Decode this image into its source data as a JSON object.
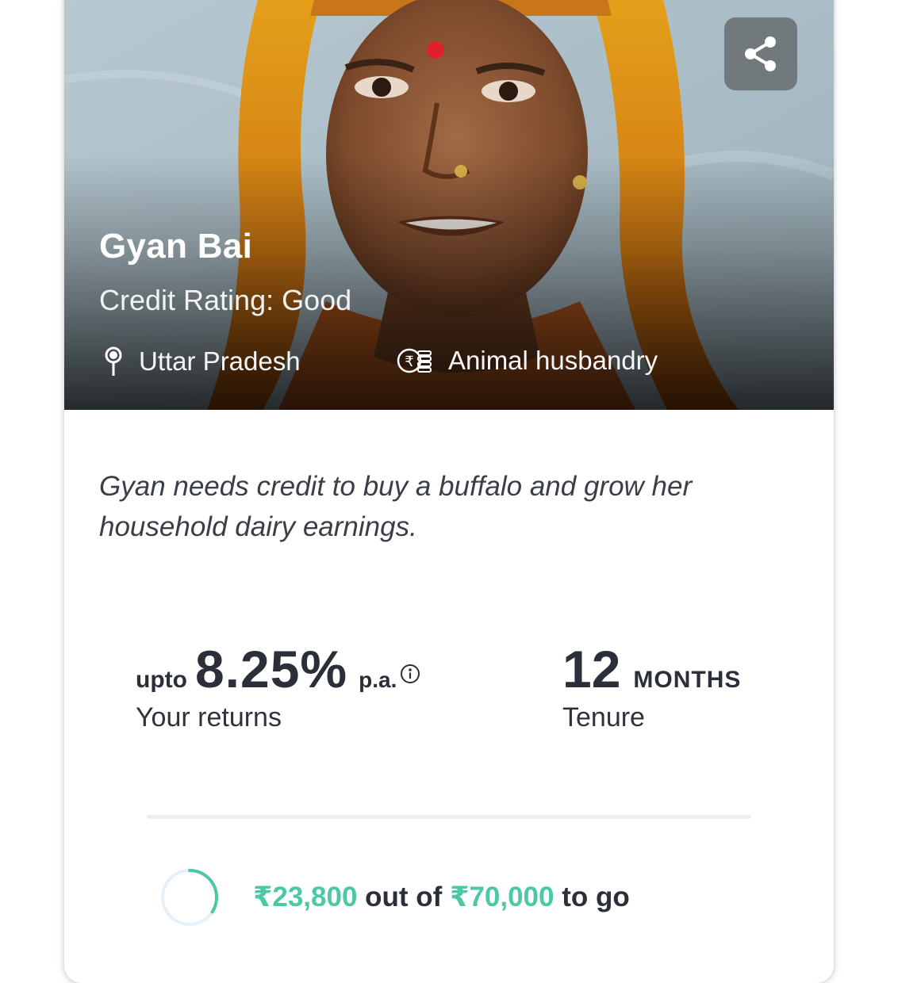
{
  "borrower": {
    "name": "Gyan Bai",
    "credit_rating": "Credit Rating: Good",
    "location": "Uttar Pradesh",
    "sector": "Animal husbandry",
    "location_icon": "map-pin-icon",
    "sector_icon": "rupee-coins-icon"
  },
  "share": {
    "icon": "share-icon"
  },
  "description": "Gyan needs credit to buy a buffalo and grow her household dairy earnings.",
  "returns": {
    "prefix": "upto",
    "rate": "8.25%",
    "suffix": "p.a.",
    "label": "Your returns",
    "info_icon": "info-icon"
  },
  "tenure": {
    "value": "12",
    "unit": "MONTHS",
    "label": "Tenure"
  },
  "funding": {
    "raised": "₹23,800",
    "connector": "out of",
    "goal": "₹70,000",
    "suffix": "to go",
    "progress_fraction": 0.34
  },
  "colors": {
    "accent": "#4cc9a4",
    "text_dark": "#2a2f39",
    "share_bg": "#6e7376"
  }
}
